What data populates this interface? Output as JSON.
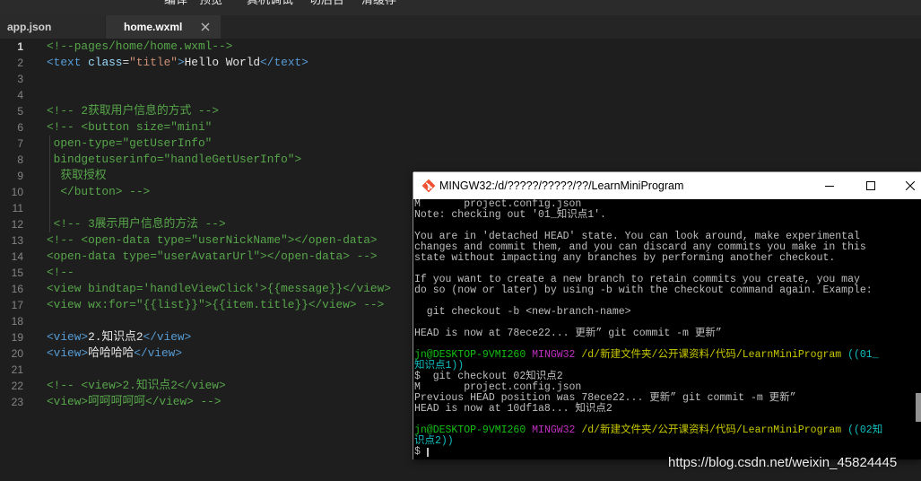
{
  "toolbar": {
    "items": [
      {
        "label": "编译"
      },
      {
        "label": "预览"
      },
      {
        "label": "真机调试"
      },
      {
        "label": "切后台"
      },
      {
        "label": "清缓存"
      }
    ]
  },
  "tabs": [
    {
      "label": "app.json",
      "active": false
    },
    {
      "label": "home.wxml",
      "active": true,
      "close_icon": "close-icon"
    }
  ],
  "colors": {
    "editor_bg": "#1e1e1e",
    "terminal_bg": "#000000",
    "terminal_title_bg": "#ffffff",
    "comment": "#57a64a"
  },
  "editor": {
    "lines": [
      {
        "n": "1",
        "current": true,
        "tokens": [
          [
            "<!--pages/home/home.wxml-->",
            "#57a64a"
          ]
        ]
      },
      {
        "n": "2",
        "tokens": [
          [
            "<text",
            "#569cd6"
          ],
          [
            " class",
            "#9cdcfe"
          ],
          [
            "=",
            "#d4d4d4"
          ],
          [
            "\"title\"",
            "#ce9178"
          ],
          [
            ">",
            "#569cd6"
          ],
          [
            "Hello World",
            "#e6e6e6"
          ],
          [
            "</text>",
            "#569cd6"
          ]
        ]
      },
      {
        "n": "3",
        "tokens": []
      },
      {
        "n": "4",
        "tokens": []
      },
      {
        "n": "5",
        "tokens": [
          [
            "<!-- 2获取用户信息的方式 -->",
            "#57a64a"
          ]
        ]
      },
      {
        "n": "6",
        "tokens": [
          [
            "<!-- <button size=\"mini\"",
            "#57a64a"
          ]
        ]
      },
      {
        "n": "7",
        "tokens": [
          [
            " open-type=\"getUserInfo\"",
            "#57a64a"
          ]
        ]
      },
      {
        "n": "8",
        "tokens": [
          [
            " bindgetuserinfo=\"handleGetUserInfo\">",
            "#57a64a"
          ]
        ]
      },
      {
        "n": "9",
        "tokens": [
          [
            "  获取授权",
            "#57a64a"
          ]
        ]
      },
      {
        "n": "10",
        "tokens": [
          [
            "  </button> -->",
            "#57a64a"
          ]
        ]
      },
      {
        "n": "11",
        "tokens": []
      },
      {
        "n": "12",
        "tokens": [
          [
            " <!-- 3展示用户信息的方法 -->",
            "#57a64a"
          ]
        ]
      },
      {
        "n": "13",
        "tokens": [
          [
            "<!-- <open-data type=\"userNickName\"></open-data>",
            "#57a64a"
          ]
        ]
      },
      {
        "n": "14",
        "tokens": [
          [
            "<open-data type=\"userAvatarUrl\"></open-data> -->",
            "#57a64a"
          ]
        ]
      },
      {
        "n": "15",
        "tokens": [
          [
            "<!--",
            "#57a64a"
          ]
        ]
      },
      {
        "n": "16",
        "tokens": [
          [
            "<view bindtap='handleViewClick'>{{message}}</view>",
            "#57a64a"
          ]
        ]
      },
      {
        "n": "17",
        "tokens": [
          [
            "<view wx:for=\"{{list}}\">{{item.title}}</view> -->",
            "#57a64a"
          ]
        ]
      },
      {
        "n": "18",
        "tokens": []
      },
      {
        "n": "19",
        "tokens": [
          [
            "<view>",
            "#569cd6"
          ],
          [
            "2.知识点2",
            "#e6e6e6"
          ],
          [
            "</view>",
            "#569cd6"
          ]
        ]
      },
      {
        "n": "20",
        "tokens": [
          [
            "<view>",
            "#569cd6"
          ],
          [
            "哈哈哈哈",
            "#e6e6e6"
          ],
          [
            "</view>",
            "#569cd6"
          ]
        ]
      },
      {
        "n": "21",
        "tokens": []
      },
      {
        "n": "22",
        "tokens": [
          [
            "<!-- <view>2.知识点2</view>",
            "#57a64a"
          ]
        ]
      },
      {
        "n": "23",
        "tokens": [
          [
            "<view>呵呵呵呵呵</view> -->",
            "#57a64a"
          ]
        ]
      }
    ]
  },
  "terminal": {
    "title": "MINGW32:/d/?????/?????/??/LearnMiniProgram",
    "icons": {
      "app": "git-icon",
      "minimize": "minimize-icon",
      "maximize": "maximize-icon",
      "close": "close-icon"
    },
    "lines": [
      [
        [
          "M       project.config.json",
          "#bfbfbf"
        ]
      ],
      [
        [
          "Note: checking out '01_知识点1'.",
          "#bfbfbf"
        ]
      ],
      [],
      [
        [
          "You are in 'detached HEAD' state. You can look around, make experimental",
          "#bfbfbf"
        ]
      ],
      [
        [
          "changes and commit them, and you can discard any commits you make in this",
          "#bfbfbf"
        ]
      ],
      [
        [
          "state without impacting any branches by performing another checkout.",
          "#bfbfbf"
        ]
      ],
      [],
      [
        [
          "If you want to create a new branch to retain commits you create, you may",
          "#bfbfbf"
        ]
      ],
      [
        [
          "do so (now or later) by using -b with the checkout command again. Example:",
          "#bfbfbf"
        ]
      ],
      [],
      [
        [
          "  git checkout -b <new-branch-name>",
          "#bfbfbf"
        ]
      ],
      [],
      [
        [
          "HEAD is now at 78ece22... 更新” git commit -m 更新”",
          "#bfbfbf"
        ]
      ],
      [],
      [
        [
          "jn@DESKTOP-9VMI260",
          "#13bf13"
        ],
        [
          " ",
          "#bfbfbf"
        ],
        [
          "MINGW32",
          "#bf2fbf"
        ],
        [
          " ",
          "#bfbfbf"
        ],
        [
          "/d/新建文件夹/公开课资料/代码/LearnMiniProgram",
          "#c8c800"
        ],
        [
          " ",
          "#bfbfbf"
        ],
        [
          "((01_",
          "#10bfbf"
        ]
      ],
      [
        [
          "知识点1))",
          "#10bfbf"
        ]
      ],
      [
        [
          "$  git checkout 02知识点2",
          "#bfbfbf"
        ]
      ],
      [
        [
          "M       project.config.json",
          "#bfbfbf"
        ]
      ],
      [
        [
          "Previous HEAD position was 78ece22... 更新” git commit -m 更新”",
          "#bfbfbf"
        ]
      ],
      [
        [
          "HEAD is now at 10df1a8... 知识点2",
          "#bfbfbf"
        ]
      ],
      [],
      [
        [
          "jn@DESKTOP-9VMI260",
          "#13bf13"
        ],
        [
          " ",
          "#bfbfbf"
        ],
        [
          "MINGW32",
          "#bf2fbf"
        ],
        [
          " ",
          "#bfbfbf"
        ],
        [
          "/d/新建文件夹/公开课资料/代码/LearnMiniProgram",
          "#c8c800"
        ],
        [
          " ",
          "#bfbfbf"
        ],
        [
          "((02知",
          "#10bfbf"
        ]
      ],
      [
        [
          "识点2))",
          "#10bfbf"
        ]
      ],
      [
        [
          "$ ",
          "#bfbfbf"
        ]
      ]
    ]
  },
  "watermark": "https://blog.csdn.net/weixin_45824445"
}
